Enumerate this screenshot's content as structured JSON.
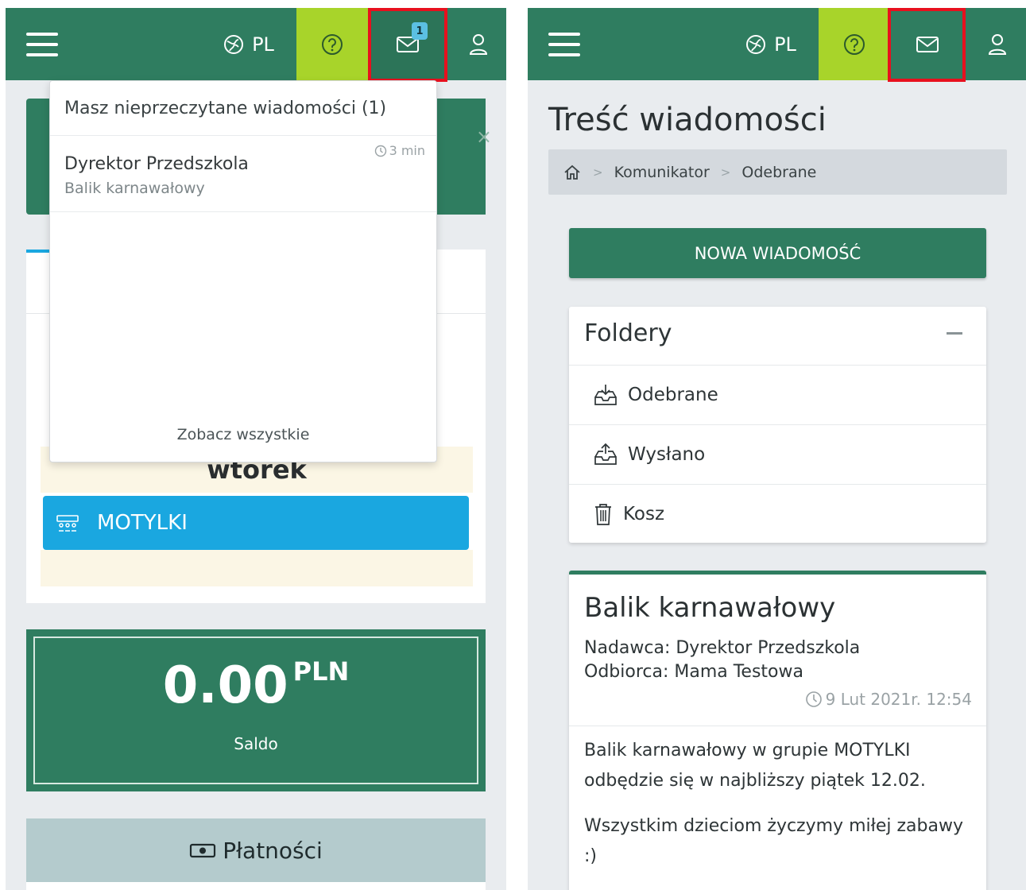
{
  "topbar": {
    "lang_label": "PL",
    "unread_count": "1"
  },
  "left_screen": {
    "dropdown": {
      "header": "Masz nieprzeczytane wiadomości (1)",
      "item": {
        "sender": "Dyrektor Przedszkola",
        "subject": "Balik karnawałowy",
        "time": "3 min"
      },
      "see_all": "Zobacz wszystkie"
    },
    "close_symbol": "×",
    "day": "wtorek",
    "group": "MOTYLKI",
    "balance": {
      "amount": "0.00",
      "currency": "PLN",
      "label": "Saldo"
    },
    "payments_title": "Płatności"
  },
  "right_screen": {
    "page_title": "Treść wiadomości",
    "breadcrumb": [
      "Komunikator",
      "Odebrane"
    ],
    "breadcrumb_sep": ">",
    "new_message_button": "NOWA WIADOMOŚĆ",
    "folders": {
      "title": "Foldery",
      "items": [
        "Odebrane",
        "Wysłano",
        "Kosz"
      ]
    },
    "message": {
      "subject": "Balik karnawałowy",
      "sender_line": "Nadawca: Dyrektor Przedszkola",
      "recipient_line": "Odbiorca: Mama Testowa",
      "date": "9 Lut 2021r. 12:54",
      "body": [
        "Balik karnawałowy w grupie MOTYLKI odbędzie się w najbliższy piątek 12.02.",
        "Wszystkim dzieciom życzymy miłej zabawy :)"
      ]
    }
  },
  "colors": {
    "primary_green": "#2f7d60",
    "help_lime": "#a8d42a",
    "group_blue": "#1aa7e0",
    "highlight_red": "#e8101e"
  }
}
